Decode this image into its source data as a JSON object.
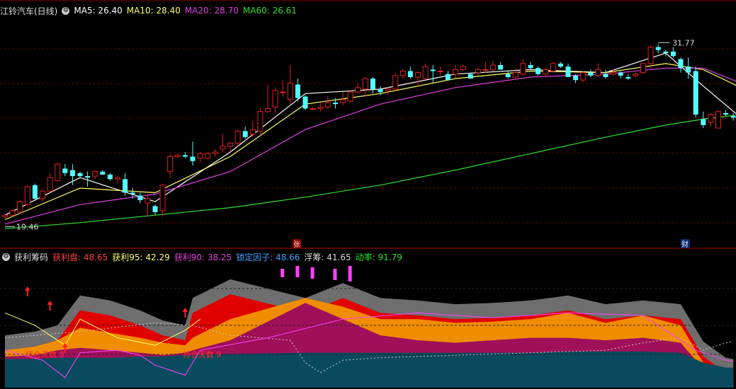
{
  "colors": {
    "up": "#e02020",
    "down": "#54ffff",
    "ma5": "#ffffff",
    "ma10": "#ffff66",
    "ma20": "#e040e0",
    "ma60": "#30e030",
    "grid": "#8b0000",
    "gray": "#6e6e6e",
    "red_band": "#e00000",
    "orange_band": "#f08c00",
    "magenta_band": "#a0105a",
    "teal_band": "#0a4a5e"
  },
  "main_header": {
    "title": "江铃汽车(日线)",
    "ma5": "MA5: 26.40",
    "ma10": "MA10: 28.40",
    "ma20": "MA20: 28.70",
    "ma60": "MA60: 26.61"
  },
  "sub_header": {
    "title": "获利筹码",
    "profit": "获利盘: 48.65",
    "profit95": "获利95: 42.29",
    "profit90": "获利90: 38.25",
    "lock": "锁定因子: 48.66",
    "float": "浮筹: 41.65",
    "momentum": "动率: 91.79"
  },
  "markers": {
    "zhang": "张",
    "cai": "财"
  },
  "annotations": {
    "high": "31.77",
    "low": "19.46",
    "hold1": "持仓天数 9",
    "hold2": "持仓天数 9"
  },
  "chart_data": {
    "type": "candlestick",
    "title": "江铃汽车(日线)",
    "ylim": [
      18.4,
      33.2
    ],
    "high_label": 31.77,
    "low_label": 19.46,
    "candles": [
      [
        19.8,
        20.0,
        19.6,
        19.9
      ],
      [
        19.9,
        20.3,
        19.8,
        20.2
      ],
      [
        20.1,
        20.9,
        20.0,
        20.8
      ],
      [
        20.6,
        21.9,
        20.5,
        21.8
      ],
      [
        21.9,
        22.0,
        20.9,
        21.0
      ],
      [
        21.0,
        21.6,
        20.8,
        21.5
      ],
      [
        21.5,
        22.7,
        21.4,
        22.4
      ],
      [
        22.2,
        23.4,
        22.1,
        23.3
      ],
      [
        23.0,
        23.3,
        22.5,
        22.7
      ],
      [
        22.9,
        23.3,
        21.9,
        22.5
      ],
      [
        22.7,
        22.8,
        22.4,
        22.5
      ],
      [
        22.5,
        22.8,
        21.8,
        22.4
      ],
      [
        22.5,
        22.9,
        22.3,
        22.8
      ],
      [
        22.8,
        22.9,
        22.6,
        22.6
      ],
      [
        22.6,
        22.7,
        22.2,
        22.3
      ],
      [
        22.3,
        22.5,
        22.0,
        22.4
      ],
      [
        22.3,
        22.7,
        21.2,
        21.4
      ],
      [
        21.4,
        21.7,
        21.0,
        21.3
      ],
      [
        21.2,
        21.4,
        20.7,
        20.9
      ],
      [
        20.7,
        21.3,
        19.8,
        21.0
      ],
      [
        20.5,
        20.6,
        19.9,
        20.1
      ],
      [
        20.2,
        22.0,
        19.8,
        21.9
      ],
      [
        22.8,
        24.0,
        22.4,
        23.8
      ],
      [
        23.8,
        24.0,
        23.7,
        23.9
      ],
      [
        23.9,
        24.1,
        23.7,
        23.8
      ],
      [
        23.8,
        24.8,
        23.2,
        23.5
      ],
      [
        23.7,
        24.1,
        23.4,
        24.0
      ],
      [
        23.7,
        24.1,
        23.6,
        24.0
      ],
      [
        24.0,
        24.3,
        23.8,
        24.1
      ],
      [
        24.3,
        25.3,
        24.1,
        24.5
      ],
      [
        24.5,
        24.8,
        24.1,
        24.7
      ],
      [
        24.7,
        25.6,
        24.5,
        25.5
      ],
      [
        25.5,
        25.8,
        25.0,
        25.1
      ],
      [
        25.3,
        26.2,
        25.1,
        25.6
      ],
      [
        25.5,
        27.0,
        25.2,
        26.8
      ],
      [
        26.8,
        28.6,
        26.7,
        27.0
      ],
      [
        27.1,
        28.4,
        26.7,
        28.2
      ],
      [
        28.1,
        28.9,
        27.8,
        28.1
      ],
      [
        27.6,
        29.9,
        27.3,
        28.7
      ],
      [
        28.6,
        29.0,
        27.5,
        27.7
      ],
      [
        27.8,
        27.9,
        26.9,
        27.0
      ],
      [
        27.0,
        27.1,
        26.9,
        27.0
      ],
      [
        27.0,
        27.4,
        26.8,
        27.1
      ],
      [
        27.1,
        27.8,
        27.0,
        27.4
      ],
      [
        27.4,
        27.7,
        27.0,
        27.3
      ],
      [
        27.4,
        28.1,
        27.2,
        27.6
      ],
      [
        27.5,
        28.2,
        27.4,
        28.1
      ],
      [
        28.1,
        28.7,
        28.0,
        28.4
      ],
      [
        28.3,
        29.1,
        27.8,
        29.0
      ],
      [
        29.0,
        29.1,
        28.0,
        28.3
      ],
      [
        28.3,
        28.5,
        27.9,
        28.1
      ],
      [
        28.2,
        28.4,
        27.9,
        28.3
      ],
      [
        28.3,
        29.4,
        28.2,
        29.2
      ],
      [
        29.2,
        29.6,
        29.0,
        29.5
      ],
      [
        29.5,
        29.8,
        29.0,
        29.1
      ],
      [
        29.1,
        29.5,
        28.6,
        29.4
      ],
      [
        29.0,
        30.0,
        28.9,
        29.8
      ],
      [
        29.6,
        29.9,
        28.7,
        29.5
      ],
      [
        29.5,
        29.8,
        29.2,
        29.5
      ],
      [
        29.3,
        29.5,
        28.9,
        28.9
      ],
      [
        29.3,
        29.9,
        29.0,
        29.6
      ],
      [
        29.6,
        29.9,
        29.5,
        29.8
      ],
      [
        29.3,
        29.4,
        29.0,
        29.0
      ],
      [
        29.4,
        29.7,
        29.2,
        29.6
      ],
      [
        29.6,
        30.1,
        29.4,
        29.6
      ],
      [
        29.6,
        30.2,
        29.5,
        29.9
      ],
      [
        29.9,
        30.1,
        29.6,
        29.6
      ],
      [
        29.3,
        29.5,
        29.0,
        29.1
      ],
      [
        29.1,
        29.7,
        28.9,
        29.4
      ],
      [
        29.3,
        30.3,
        29.2,
        30.0
      ],
      [
        29.9,
        30.1,
        29.6,
        29.7
      ],
      [
        29.7,
        29.8,
        29.2,
        29.3
      ],
      [
        29.3,
        29.7,
        29.2,
        29.6
      ],
      [
        29.5,
        30.1,
        29.4,
        30.0
      ],
      [
        30.0,
        30.1,
        29.7,
        29.8
      ],
      [
        29.8,
        30.0,
        29.1,
        29.1
      ],
      [
        29.2,
        29.3,
        28.7,
        28.9
      ],
      [
        28.9,
        29.5,
        28.8,
        29.4
      ],
      [
        29.4,
        29.6,
        29.1,
        29.2
      ],
      [
        29.2,
        30.0,
        29.1,
        29.6
      ],
      [
        29.3,
        29.6,
        29.0,
        29.1
      ],
      [
        29.3,
        29.6,
        29.2,
        29.4
      ],
      [
        29.4,
        29.5,
        29.0,
        29.2
      ],
      [
        29.1,
        29.3,
        28.9,
        29.0
      ],
      [
        29.2,
        29.4,
        29.1,
        29.3
      ],
      [
        29.4,
        30.0,
        29.3,
        30.0
      ],
      [
        30.0,
        31.2,
        29.7,
        31.1
      ],
      [
        31.1,
        31.3,
        30.7,
        30.9
      ],
      [
        30.8,
        30.9,
        30.5,
        30.7
      ],
      [
        30.8,
        31.1,
        30.4,
        30.5
      ],
      [
        30.3,
        30.4,
        29.4,
        29.7
      ],
      [
        29.8,
        30.4,
        29.0,
        29.4
      ],
      [
        29.5,
        29.8,
        26.4,
        26.6
      ],
      [
        26.3,
        26.8,
        25.7,
        25.9
      ],
      [
        26.1,
        26.7,
        25.8,
        26.6
      ],
      [
        25.7,
        26.9,
        25.7,
        26.8
      ],
      [
        26.7,
        26.9,
        26.5,
        26.6
      ],
      [
        26.5,
        26.7,
        26.2,
        26.4
      ]
    ],
    "ma_lines": {
      "MA5": [
        [
          0,
          19.9
        ],
        [
          10,
          22.4
        ],
        [
          20,
          20.8
        ],
        [
          30,
          24.1
        ],
        [
          40,
          28.0
        ],
        [
          50,
          28.3
        ],
        [
          60,
          29.3
        ],
        [
          70,
          29.6
        ],
        [
          80,
          29.4
        ],
        [
          88,
          30.7
        ],
        [
          93,
          28.5
        ],
        [
          98,
          26.4
        ]
      ],
      "MA10": [
        [
          0,
          19.6
        ],
        [
          10,
          21.7
        ],
        [
          20,
          21.4
        ],
        [
          30,
          23.8
        ],
        [
          40,
          27.3
        ],
        [
          50,
          28.0
        ],
        [
          60,
          29.0
        ],
        [
          70,
          29.5
        ],
        [
          80,
          29.4
        ],
        [
          88,
          30.0
        ],
        [
          93,
          29.6
        ],
        [
          98,
          28.4
        ]
      ],
      "MA20": [
        [
          0,
          19.3
        ],
        [
          10,
          20.6
        ],
        [
          20,
          21.3
        ],
        [
          30,
          22.8
        ],
        [
          40,
          25.6
        ],
        [
          50,
          27.3
        ],
        [
          60,
          28.4
        ],
        [
          70,
          29.1
        ],
        [
          80,
          29.3
        ],
        [
          88,
          29.7
        ],
        [
          93,
          29.7
        ],
        [
          98,
          28.7
        ]
      ],
      "MA60": [
        [
          0,
          19.0
        ],
        [
          10,
          19.4
        ],
        [
          20,
          19.9
        ],
        [
          30,
          20.4
        ],
        [
          40,
          21.1
        ],
        [
          50,
          21.9
        ],
        [
          60,
          22.9
        ],
        [
          70,
          24.0
        ],
        [
          80,
          25.1
        ],
        [
          88,
          25.9
        ],
        [
          93,
          26.3
        ],
        [
          98,
          26.6
        ]
      ]
    },
    "sub_chart": {
      "series": [
        {
          "name": "获利盘",
          "values": [
            [
              0,
              30
            ],
            [
              4,
              33
            ],
            [
              7,
              38
            ],
            [
              10,
              62
            ],
            [
              14,
              58
            ],
            [
              18,
              50
            ],
            [
              21,
              42
            ],
            [
              24,
              38
            ],
            [
              25,
              60
            ],
            [
              30,
              75
            ],
            [
              40,
              60
            ],
            [
              45,
              72
            ],
            [
              50,
              60
            ],
            [
              55,
              58
            ],
            [
              60,
              55
            ],
            [
              65,
              56
            ],
            [
              70,
              58
            ],
            [
              75,
              62
            ],
            [
              80,
              55
            ],
            [
              85,
              58
            ],
            [
              90,
              55
            ],
            [
              93,
              25
            ],
            [
              96,
              12
            ],
            [
              98,
              10
            ]
          ]
        },
        {
          "name": "获利95",
          "values": [
            [
              0,
              30
            ],
            [
              4,
              33
            ],
            [
              7,
              38
            ],
            [
              10,
              48
            ],
            [
              14,
              44
            ],
            [
              18,
              40
            ],
            [
              21,
              36
            ],
            [
              24,
              34
            ],
            [
              25,
              40
            ],
            [
              30,
              55
            ],
            [
              40,
              72
            ],
            [
              45,
              65
            ],
            [
              50,
              55
            ],
            [
              55,
              55
            ],
            [
              60,
              52
            ],
            [
              65,
              53
            ],
            [
              70,
              55
            ],
            [
              75,
              60
            ],
            [
              80,
              52
            ],
            [
              85,
              58
            ],
            [
              90,
              50
            ],
            [
              93,
              20
            ],
            [
              96,
              10
            ],
            [
              98,
              9
            ]
          ]
        },
        {
          "name": "获利90",
          "values": [
            [
              0,
              25
            ],
            [
              4,
              26
            ],
            [
              7,
              30
            ],
            [
              10,
              32
            ],
            [
              14,
              30
            ],
            [
              18,
              28
            ],
            [
              21,
              26
            ],
            [
              24,
              28
            ],
            [
              25,
              30
            ],
            [
              30,
              38
            ],
            [
              40,
              68
            ],
            [
              45,
              55
            ],
            [
              50,
              42
            ],
            [
              55,
              38
            ],
            [
              60,
              36
            ],
            [
              65,
              38
            ],
            [
              70,
              40
            ],
            [
              75,
              40
            ],
            [
              80,
              38
            ],
            [
              85,
              40
            ],
            [
              90,
              36
            ],
            [
              93,
              15
            ],
            [
              96,
              6
            ],
            [
              98,
              5
            ]
          ]
        },
        {
          "name": "锁定因子",
          "values": [
            [
              0,
              23
            ],
            [
              4,
              23
            ],
            [
              7,
              24
            ],
            [
              10,
              24
            ],
            [
              14,
              24
            ],
            [
              18,
              25
            ],
            [
              21,
              25
            ],
            [
              24,
              26
            ],
            [
              25,
              26
            ],
            [
              30,
              27
            ],
            [
              40,
              28
            ],
            [
              45,
              28
            ],
            [
              50,
              28
            ],
            [
              55,
              28
            ],
            [
              60,
              28
            ],
            [
              65,
              28
            ],
            [
              70,
              28
            ],
            [
              75,
              29
            ],
            [
              80,
              29
            ],
            [
              85,
              29
            ],
            [
              90,
              28
            ],
            [
              93,
              20
            ],
            [
              96,
              16
            ],
            [
              98,
              16
            ]
          ]
        }
      ]
    }
  }
}
